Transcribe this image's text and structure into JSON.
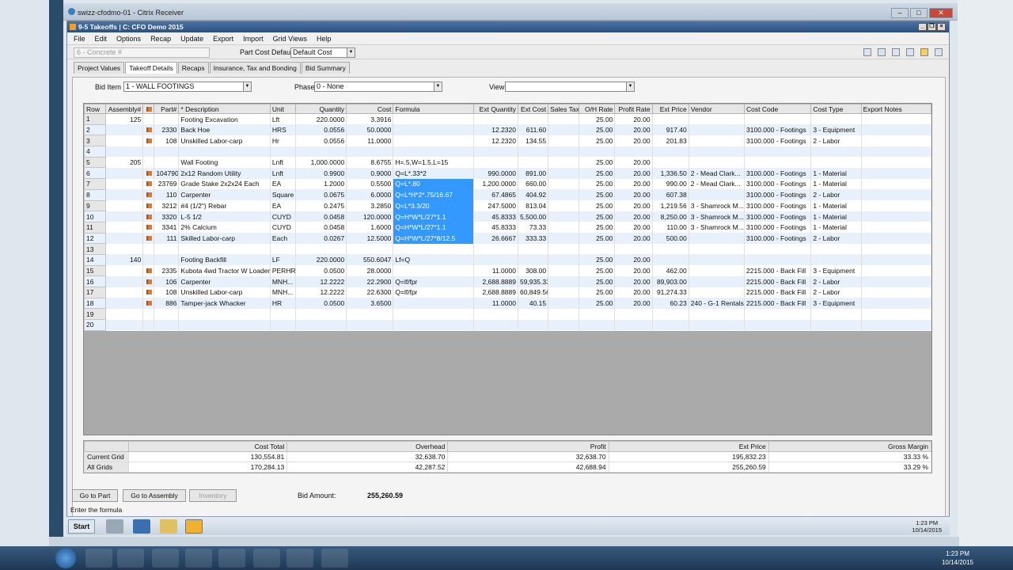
{
  "outer_window": {
    "title": "swizz-cfodmo-01 - Citrix Receiver"
  },
  "app": {
    "title": "9-5 Takeoffs  |  C: CFO Demo 2015"
  },
  "menu": [
    "File",
    "Edit",
    "Options",
    "Recap",
    "Update",
    "Export",
    "Import",
    "Grid Views",
    "Help"
  ],
  "toolbar": {
    "search_placeholder": "6 - Concrete #",
    "part_cost_label": "Part Cost Default",
    "part_cost_value": "Default Cost"
  },
  "tabs": [
    "Project Values",
    "Takeoff Details",
    "Recaps",
    "Insurance, Tax and Bonding",
    "Bid Summary"
  ],
  "active_tab": 1,
  "filters": {
    "bid_item_label": "Bid Item",
    "bid_item_value": "1 - WALL FOOTINGS",
    "phase_label": "Phase",
    "phase_value": "0 - None",
    "view_label": "View",
    "view_value": ""
  },
  "grid": {
    "columns": [
      "Row",
      "Assembly#",
      "",
      "Part#",
      "* Description",
      "Unit",
      "Quantity",
      "Cost",
      "Formula",
      "Ext Quantity",
      "Ext Cost",
      "Sales Tax",
      "O/H Rate",
      "Profit Rate",
      "Ext Price",
      "Vendor",
      "Cost Code",
      "Cost Type",
      "Export Notes"
    ],
    "rows": [
      [
        "1",
        "125",
        "",
        "",
        "Footing Excavation",
        "Lft",
        "220.0000",
        "3.3916",
        "",
        "",
        "",
        "",
        "25.00",
        "20.00",
        "",
        "",
        "",
        "",
        ""
      ],
      [
        "2",
        "",
        "F",
        "2330",
        "Back Hoe",
        "HRS",
        "0.0556",
        "50.0000",
        "",
        "12.2320",
        "611.60",
        "",
        "25.00",
        "20.00",
        "917.40",
        "",
        "3100.000 - Footings",
        "3 - Equipment",
        ""
      ],
      [
        "3",
        "",
        "F",
        "108",
        "Unskilled Labor-carp",
        "Hr",
        "0.0556",
        "11.0000",
        "",
        "12.2320",
        "134.55",
        "",
        "25.00",
        "20.00",
        "201.83",
        "",
        "3100.000 - Footings",
        "2 - Labor",
        ""
      ],
      [
        "4",
        "",
        "",
        "",
        "",
        "",
        "",
        "",
        "",
        "",
        "",
        "",
        "",
        "",
        "",
        "",
        "",
        "",
        ""
      ],
      [
        "5",
        "205",
        "",
        "",
        "Wall Footing",
        "Lnft",
        "1,000.0000",
        "8.6755",
        "H=.5,W=1.5,L=15",
        "",
        "",
        "",
        "25.00",
        "20.00",
        "",
        "",
        "",
        "",
        ""
      ],
      [
        "6",
        "",
        "F",
        "104790",
        "2x12 Random Utility",
        "Lnft",
        "0.9900",
        "0.9000",
        "Q=L*.33*2",
        "990.0000",
        "891.00",
        "",
        "25.00",
        "20.00",
        "1,336.50",
        "2 - Mead Clark...",
        "3100.000 - Footings",
        "1 - Material",
        ""
      ],
      [
        "7",
        "",
        "F",
        "23769",
        "Grade Stake  2x2x24 Each",
        "EA",
        "1.2000",
        "0.5500",
        "Q=L*.80",
        "1,200.0000",
        "660.00",
        "",
        "25.00",
        "20.00",
        "990.00",
        "2 - Mead Clark...",
        "3100.000 - Footings",
        "1 - Material",
        ""
      ],
      [
        "8",
        "",
        "F",
        "110",
        "Carpenter",
        "Square",
        "0.0675",
        "6.0000",
        "Q=L*H*2*.75/16.67",
        "67.4865",
        "404.92",
        "",
        "25.00",
        "20.00",
        "607.38",
        "",
        "3100.000 - Footings",
        "2 - Labor",
        ""
      ],
      [
        "9",
        "",
        "F",
        "3212",
        "#4 (1/2\") Rebar",
        "EA",
        "0.2475",
        "3.2850",
        "Q=L*3.3/20",
        "247.5000",
        "813.04",
        "",
        "25.00",
        "20.00",
        "1,219.56",
        "3 - Shamrock M...",
        "3100.000 - Footings",
        "1 - Material",
        ""
      ],
      [
        "10",
        "",
        "F",
        "3320",
        "L-5 1/2",
        "CUYD",
        "0.0458",
        "120.0000",
        "Q=H*W*L/27*1.1",
        "45.8333",
        "5,500.00",
        "",
        "25.00",
        "20.00",
        "8,250.00",
        "3 - Shamrock M...",
        "3100.000 - Footings",
        "1 - Material",
        ""
      ],
      [
        "11",
        "",
        "F",
        "3341",
        "2% Calcium",
        "CUYD",
        "0.0458",
        "1.6000",
        "Q=H*W*L/27*1.1",
        "45.8333",
        "73.33",
        "",
        "25.00",
        "20.00",
        "110.00",
        "3 - Shamrock M...",
        "3100.000 - Footings",
        "1 - Material",
        ""
      ],
      [
        "12",
        "",
        "F",
        "111",
        "Skilled Labor-carp",
        "Each",
        "0.0267",
        "12.5000",
        "Q=H*W*L/27*8/12.5",
        "26.6667",
        "333.33",
        "",
        "25.00",
        "20.00",
        "500.00",
        "",
        "3100.000 - Footings",
        "2 - Labor",
        ""
      ],
      [
        "13",
        "",
        "",
        "",
        "",
        "",
        "",
        "",
        "",
        "",
        "",
        "",
        "",
        "",
        "",
        "",
        "",
        "",
        ""
      ],
      [
        "14",
        "140",
        "",
        "",
        "Footing Backfill",
        "LF",
        "220.0000",
        "550.6047",
        "Lf=Q",
        "",
        "",
        "",
        "25.00",
        "20.00",
        "",
        "",
        "",
        "",
        ""
      ],
      [
        "15",
        "",
        "F",
        "2335",
        "Kubota 4wd Tractor W Loader",
        "PERHR",
        "0.0500",
        "28.0000",
        "",
        "11.0000",
        "308.00",
        "",
        "25.00",
        "20.00",
        "462.00",
        "",
        "2215.000 - Back Fill",
        "3 - Equipment",
        ""
      ],
      [
        "16",
        "",
        "F",
        "106",
        "Carpenter",
        "MNH...",
        "12.2222",
        "22.2900",
        "Q=lf/fpr",
        "2,688.8889",
        "59,935.33",
        "",
        "25.00",
        "20.00",
        "89,903.00",
        "",
        "2215.000 - Back Fill",
        "2 - Labor",
        ""
      ],
      [
        "17",
        "",
        "F",
        "108",
        "Unskilled Labor-carp",
        "MNH...",
        "12.2222",
        "22.6300",
        "Q=lf/fpr",
        "2,688.8889",
        "60,849.56",
        "",
        "25.00",
        "20.00",
        "91,274.33",
        "",
        "2215.000 - Back Fill",
        "2 - Labor",
        ""
      ],
      [
        "18",
        "",
        "F",
        "886",
        "Tamper-jack Whacker",
        "HR",
        "0.0500",
        "3.6500",
        "",
        "11.0000",
        "40.15",
        "",
        "25.00",
        "20.00",
        "60.23",
        "240 - G-1 Rentals",
        "2215.000 - Back Fill",
        "3 - Equipment",
        ""
      ],
      [
        "19",
        "",
        "",
        "",
        "",
        "",
        "",
        "",
        "",
        "",
        "",
        "",
        "",
        "",
        "",
        "",
        "",
        "",
        ""
      ],
      [
        "20",
        "",
        "",
        "",
        "",
        "",
        "",
        "",
        "",
        "",
        "",
        "",
        "",
        "",
        "",
        "",
        "",
        "",
        ""
      ]
    ],
    "selected_formula_rows": [
      7,
      8,
      9,
      10,
      11,
      12
    ]
  },
  "summary": {
    "headers": [
      "",
      "Cost Total",
      "Overhead",
      "Profit",
      "Ext Price",
      "Gross Margin"
    ],
    "rows": [
      [
        "Current Grid",
        "130,554.81",
        "32,638.70",
        "32,638.70",
        "195,832.23",
        "33.33 %"
      ],
      [
        "All Grids",
        "170,284.13",
        "42,287.52",
        "42,688.94",
        "255,260.59",
        "33.29 %"
      ]
    ]
  },
  "buttons": {
    "go_to_part": "Go to Part",
    "go_to_assembly": "Go to Assembly",
    "inventory": "Inventory"
  },
  "bid_amount": {
    "label": "Bid Amount:",
    "value": "255,260.59"
  },
  "status_text": "Enter the formula",
  "inner_taskbar": {
    "start": "Start",
    "time": "1:23 PM",
    "date": "10/14/2015"
  },
  "outer_taskbar": {
    "time": "1:23 PM",
    "date": "10/14/2015"
  }
}
